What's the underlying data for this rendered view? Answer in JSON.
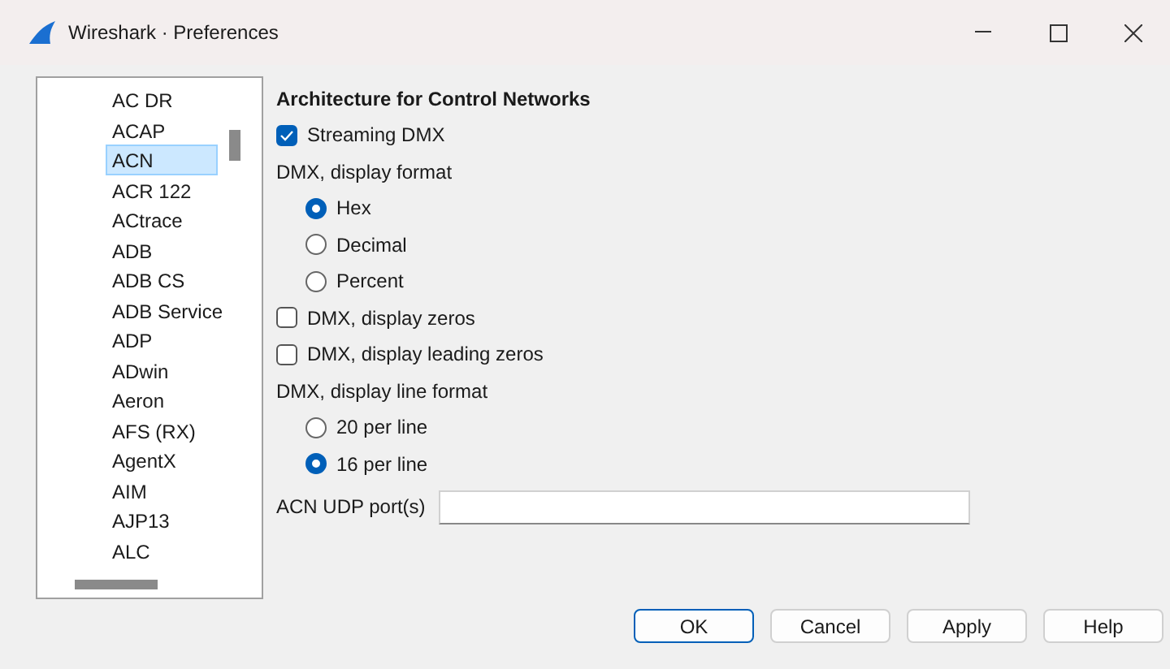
{
  "window": {
    "title": "Wireshark · Preferences"
  },
  "sidebar": {
    "items": [
      {
        "label": "AC DR",
        "selected": false
      },
      {
        "label": "ACAP",
        "selected": false
      },
      {
        "label": "ACN",
        "selected": true
      },
      {
        "label": "ACR 122",
        "selected": false
      },
      {
        "label": "ACtrace",
        "selected": false
      },
      {
        "label": "ADB",
        "selected": false
      },
      {
        "label": "ADB CS",
        "selected": false
      },
      {
        "label": "ADB Service",
        "selected": false
      },
      {
        "label": "ADP",
        "selected": false
      },
      {
        "label": "ADwin",
        "selected": false
      },
      {
        "label": "Aeron",
        "selected": false
      },
      {
        "label": "AFS (RX)",
        "selected": false
      },
      {
        "label": "AgentX",
        "selected": false
      },
      {
        "label": "AIM",
        "selected": false
      },
      {
        "label": "AJP13",
        "selected": false
      },
      {
        "label": "ALC",
        "selected": false
      }
    ]
  },
  "panel": {
    "title": "Architecture for Control Networks",
    "settings": [
      {
        "kind": "checkbox",
        "label": "Streaming DMX",
        "checked": true
      },
      {
        "kind": "label",
        "label": "DMX, display format"
      },
      {
        "kind": "radio",
        "label": "Hex",
        "selected": true
      },
      {
        "kind": "radio",
        "label": "Decimal",
        "selected": false
      },
      {
        "kind": "radio",
        "label": "Percent",
        "selected": false
      },
      {
        "kind": "checkbox",
        "label": "DMX, display zeros",
        "checked": false
      },
      {
        "kind": "checkbox",
        "label": "DMX, display leading zeros",
        "checked": false
      },
      {
        "kind": "label",
        "label": "DMX, display line format"
      },
      {
        "kind": "radio",
        "label": "20 per line",
        "selected": false
      },
      {
        "kind": "radio",
        "label": "16 per line",
        "selected": true
      },
      {
        "kind": "field",
        "label": "ACN UDP port(s)"
      }
    ]
  },
  "buttons": [
    {
      "label": "OK",
      "default": true
    },
    {
      "label": "Cancel",
      "default": false
    },
    {
      "label": "Apply",
      "default": false
    },
    {
      "label": "Help",
      "default": false
    }
  ]
}
